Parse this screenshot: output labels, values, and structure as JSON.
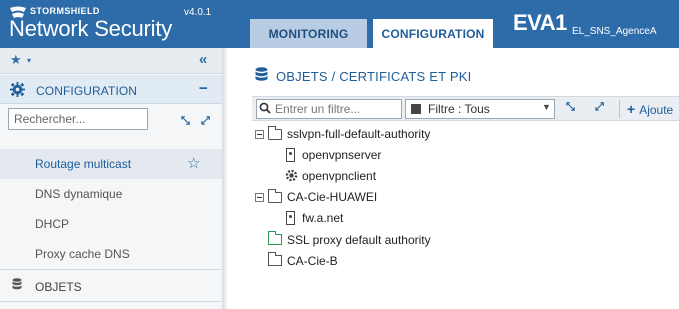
{
  "header": {
    "brand_top": "STORMSHIELD",
    "brand_product": "Network Security",
    "version": "v4.0.1",
    "tabs": [
      {
        "label": "MONITORING"
      },
      {
        "label": "CONFIGURATION"
      }
    ],
    "device_name": "EVA1",
    "device_sub": "EL_SNS_AgenceA"
  },
  "sidebar": {
    "favorites_icon": "star-icon",
    "collapse_icon": "double-chevron-left-icon",
    "section_label": "CONFIGURATION",
    "search_placeholder": "Rechercher...",
    "items": [
      {
        "label": "Routage multicast",
        "active": true
      },
      {
        "label": "DNS dynamique"
      },
      {
        "label": "DHCP"
      },
      {
        "label": "Proxy cache DNS"
      }
    ],
    "section2_label": "OBJETS"
  },
  "main": {
    "title": "OBJETS / CERTIFICATS ET PKI",
    "filter_placeholder": "Entrer un filtre...",
    "filter_select": "Filtre : Tous",
    "add_label": "Ajoute",
    "tree": [
      {
        "label": "sslvpn-full-default-authority",
        "type": "ca-folder"
      },
      {
        "label": "openvpnserver",
        "type": "server-cert"
      },
      {
        "label": "openvpnclient",
        "type": "client-cert"
      },
      {
        "label": "CA-Cie-HUAWEI",
        "type": "ca-folder"
      },
      {
        "label": "fw.a.net",
        "type": "server-cert"
      },
      {
        "label": "SSL proxy default authority",
        "type": "ca-green"
      },
      {
        "label": "CA-Cie-B",
        "type": "ca-plain"
      }
    ]
  },
  "colors": {
    "header_bg": "#2d6ba9",
    "accent": "#1f5d99",
    "tab_inactive": "#b8cde3",
    "sidebar_bg": "#f4f6f8",
    "ca_green": "#2d9a4b"
  }
}
